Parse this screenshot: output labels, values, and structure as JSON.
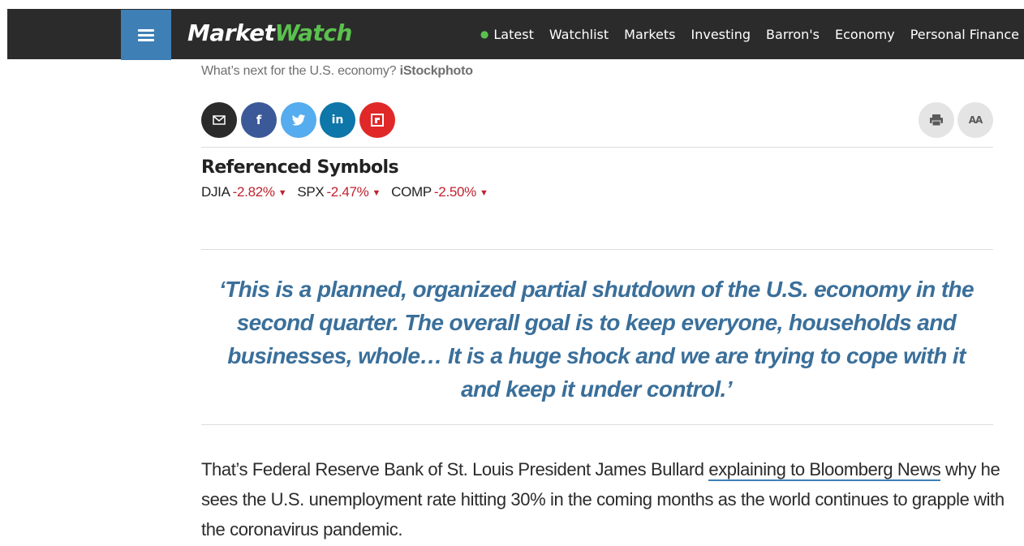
{
  "header": {
    "logo_market": "Market",
    "logo_watch": "Watch",
    "nav": [
      "Latest",
      "Watchlist",
      "Markets",
      "Investing",
      "Barron's",
      "Economy",
      "Personal Finance"
    ]
  },
  "caption": {
    "text": "What’s next for the U.S. economy?",
    "credit": "iStockphoto"
  },
  "share": {
    "email_icon": "email-icon",
    "facebook_icon": "facebook-icon",
    "twitter_icon": "twitter-icon",
    "linkedin_icon": "linkedin-icon",
    "flipboard_icon": "flipboard-icon",
    "print_icon": "print-icon",
    "text_size_icon": "text-size-icon",
    "text_size_label": "AA"
  },
  "referenced_symbols": {
    "title": "Referenced Symbols",
    "items": [
      {
        "ticker": "DJIA",
        "change": "-2.82%"
      },
      {
        "ticker": "SPX",
        "change": "-2.47%"
      },
      {
        "ticker": "COMP",
        "change": "-2.50%"
      }
    ]
  },
  "quote": {
    "text": "‘This is a planned, organized partial shutdown of the U.S. economy in the second quarter. The overall goal is to keep everyone, households and businesses, whole… It is a huge shock and we are trying to cope with it and keep it under control.’"
  },
  "article": {
    "p1_before": "That’s Federal Reserve Bank of St. Louis President James Bullard ",
    "p1_link": "explaining to Bloomberg News",
    "p1_after": " why he sees the U.S. unemployment rate hitting 30% in the coming months as the world continues to grapple with the coronavirus pandemic."
  },
  "colors": {
    "header_bg": "#2b2b2b",
    "menu_bg": "#3e7fb6",
    "brand_green": "#5bc14e",
    "negative_red": "#c0222f",
    "quote_blue": "#3a6f9a"
  }
}
